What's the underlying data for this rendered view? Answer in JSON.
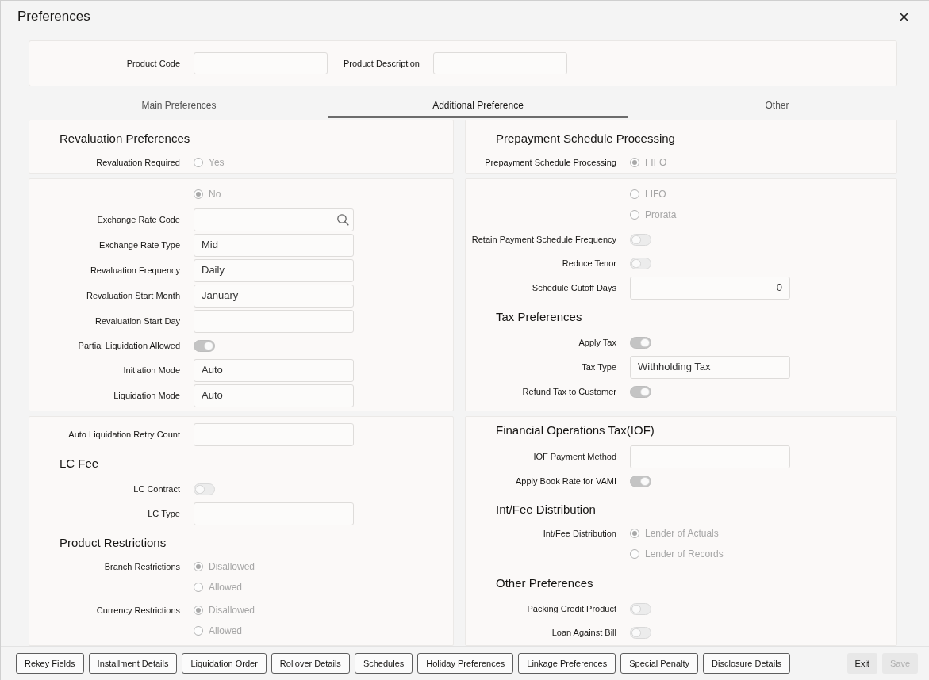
{
  "window": {
    "title": "Preferences"
  },
  "product": {
    "fields": [
      {
        "label": "Product Code"
      },
      {
        "label": "Product Description"
      }
    ]
  },
  "tabs": [
    {
      "label": "Main Preferences",
      "selected": false
    },
    {
      "label": "Additional Preference",
      "selected": true
    },
    {
      "label": "Other",
      "selected": false
    }
  ],
  "columns": [
    {
      "panels": [
        {
          "items": [
            {
              "kind": "heading",
              "text": "Revaluation Preferences"
            },
            {
              "kind": "radio",
              "label": "Revaluation Required",
              "disabled": true,
              "options": [
                {
                  "text": "Yes",
                  "selected": false
                }
              ]
            }
          ]
        },
        {
          "items": [
            {
              "kind": "radio",
              "disabled": true,
              "options": [
                {
                  "text": "No",
                  "selected": true
                }
              ]
            },
            {
              "kind": "lookup",
              "label": "Exchange Rate Code"
            },
            {
              "kind": "input",
              "label": "Exchange Rate Type",
              "value": "Mid"
            },
            {
              "kind": "input",
              "label": "Revaluation Frequency",
              "value": "Daily"
            },
            {
              "kind": "input",
              "label": "Revaluation Start Month",
              "value": "January"
            },
            {
              "kind": "input",
              "label": "Revaluation Start Day"
            },
            {
              "kind": "toggle",
              "label": "Partial Liquidation Allowed",
              "on": true
            },
            {
              "kind": "input",
              "label": "Initiation Mode",
              "value": "Auto"
            },
            {
              "kind": "input",
              "label": "Liquidation Mode",
              "value": "Auto"
            }
          ]
        },
        {
          "items": [
            {
              "kind": "input",
              "label": "Auto Liquidation Retry Count"
            },
            {
              "kind": "heading",
              "text": "LC Fee"
            },
            {
              "kind": "toggle",
              "label": "LC Contract",
              "on": false
            },
            {
              "kind": "input",
              "label": "LC Type"
            },
            {
              "kind": "heading",
              "text": "Product Restrictions"
            },
            {
              "kind": "radio",
              "label": "Branch Restrictions",
              "disabled": true,
              "options": [
                {
                  "text": "Disallowed",
                  "selected": true
                },
                {
                  "text": "Allowed",
                  "selected": false
                }
              ]
            },
            {
              "kind": "radio",
              "label": "Currency Restrictions",
              "disabled": true,
              "options": [
                {
                  "text": "Disallowed",
                  "selected": true
                },
                {
                  "text": "Allowed",
                  "selected": false
                }
              ]
            }
          ]
        }
      ]
    },
    {
      "panels": [
        {
          "items": [
            {
              "kind": "heading",
              "text": "Prepayment Schedule Processing"
            },
            {
              "kind": "radio",
              "label": "Prepayment Schedule Processing",
              "disabled": true,
              "options": [
                {
                  "text": "FIFO",
                  "selected": true
                }
              ]
            }
          ]
        },
        {
          "items": [
            {
              "kind": "radio",
              "disabled": true,
              "options": [
                {
                  "text": "LIFO",
                  "selected": false
                },
                {
                  "text": "Prorata",
                  "selected": false
                }
              ]
            },
            {
              "kind": "toggle",
              "label": "Retain Payment Schedule Frequency",
              "on": false
            },
            {
              "kind": "toggle",
              "label": "Reduce Tenor",
              "on": false
            },
            {
              "kind": "number",
              "label": "Schedule Cutoff Days",
              "value": "0"
            },
            {
              "kind": "heading",
              "text": "Tax Preferences"
            },
            {
              "kind": "toggle",
              "label": "Apply Tax",
              "on": true
            },
            {
              "kind": "input",
              "label": "Tax Type",
              "value": "Withholding Tax"
            },
            {
              "kind": "toggle",
              "label": "Refund Tax to Customer",
              "on": true
            }
          ]
        },
        {
          "items": [
            {
              "kind": "heading",
              "text": "Financial Operations Tax(IOF)"
            },
            {
              "kind": "input",
              "label": "IOF Payment Method"
            },
            {
              "kind": "toggle",
              "label": "Apply Book Rate for VAMI",
              "on": true
            },
            {
              "kind": "heading",
              "text": "Int/Fee Distribution"
            },
            {
              "kind": "radio",
              "label": "Int/Fee Distribution",
              "disabled": true,
              "options": [
                {
                  "text": "Lender of Actuals",
                  "selected": true
                },
                {
                  "text": "Lender of Records",
                  "selected": false
                }
              ]
            },
            {
              "kind": "heading",
              "text": "Other Preferences"
            },
            {
              "kind": "toggle",
              "label": "Packing Credit Product",
              "on": false
            },
            {
              "kind": "toggle",
              "label": "Loan Against Bill",
              "on": false
            }
          ]
        }
      ]
    }
  ],
  "buttons": [
    "Rekey Fields",
    "Installment Details",
    "Liquidation Order",
    "Rollover Details",
    "Schedules",
    "Holiday Preferences",
    "Linkage Preferences",
    "Special Penalty",
    "Disclosure Details"
  ],
  "actions": [
    {
      "label": "Exit",
      "disabled": false
    },
    {
      "label": "Save",
      "disabled": true
    }
  ]
}
